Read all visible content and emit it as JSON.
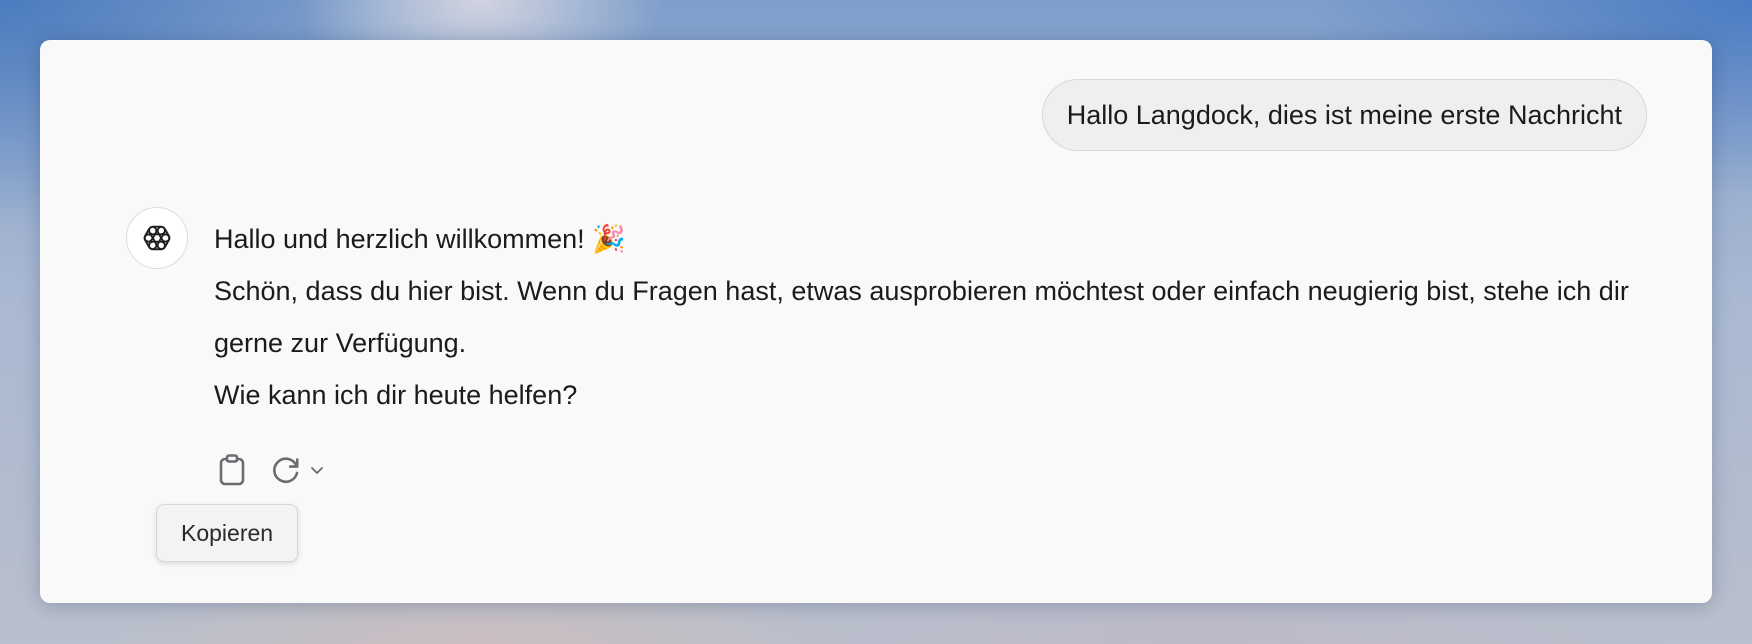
{
  "conversation": {
    "user_message": "Hallo Langdock, dies ist meine erste Nachricht",
    "assistant": {
      "avatar_icon": "openai-logo-icon",
      "lines": [
        "Hallo und herzlich willkommen! 🎉",
        "Schön, dass du hier bist. Wenn du Fragen hast, etwas ausprobieren möchtest oder einfach neugierig bist, stehe ich dir gerne zur Verfügung.",
        "Wie kann ich dir heute helfen?"
      ]
    }
  },
  "actions": {
    "copy_icon": "clipboard-icon",
    "regenerate_icon": "refresh-icon",
    "more_icon": "chevron-down-icon",
    "tooltip": "Kopieren"
  },
  "colors": {
    "panel_bg": "#f9f9f9",
    "bubble_bg": "#efefef",
    "text": "#1b1b1f",
    "icon": "#6b6b70"
  }
}
